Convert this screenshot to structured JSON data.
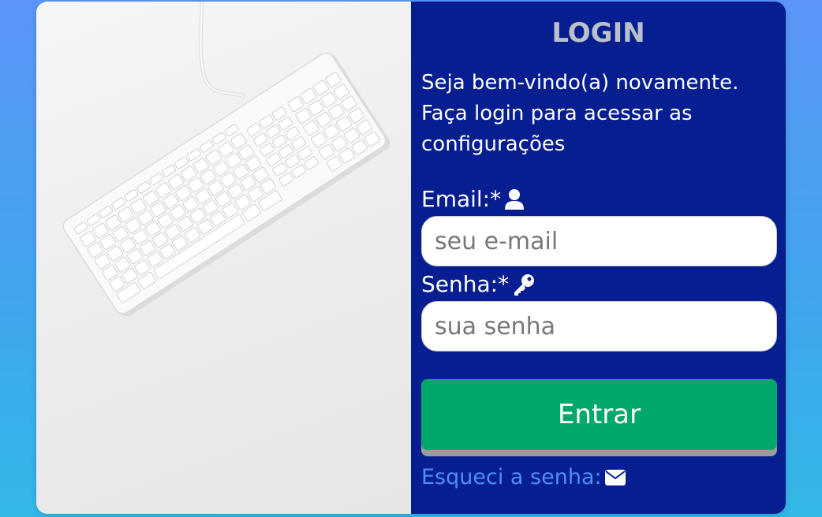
{
  "colors": {
    "panel_bg": "#061e8f",
    "button_bg": "#02a86b",
    "link": "#4f8df7",
    "title": "#b9c0cc"
  },
  "login": {
    "title": "LOGIN",
    "welcome_line1": "Seja bem-vindo(a) novamente.",
    "welcome_line2": "Faça login para acessar as",
    "welcome_line3": "configurações",
    "email_label": "Email:*",
    "email_icon": "user-icon",
    "email_placeholder": "seu e-mail",
    "password_label": "Senha:*",
    "password_icon": "key-icon",
    "password_placeholder": "sua senha",
    "submit_label": "Entrar",
    "forgot_label": "Esqueci a senha:",
    "forgot_icon": "envelope-icon"
  },
  "illustration": {
    "subject": "keyboard-image"
  }
}
